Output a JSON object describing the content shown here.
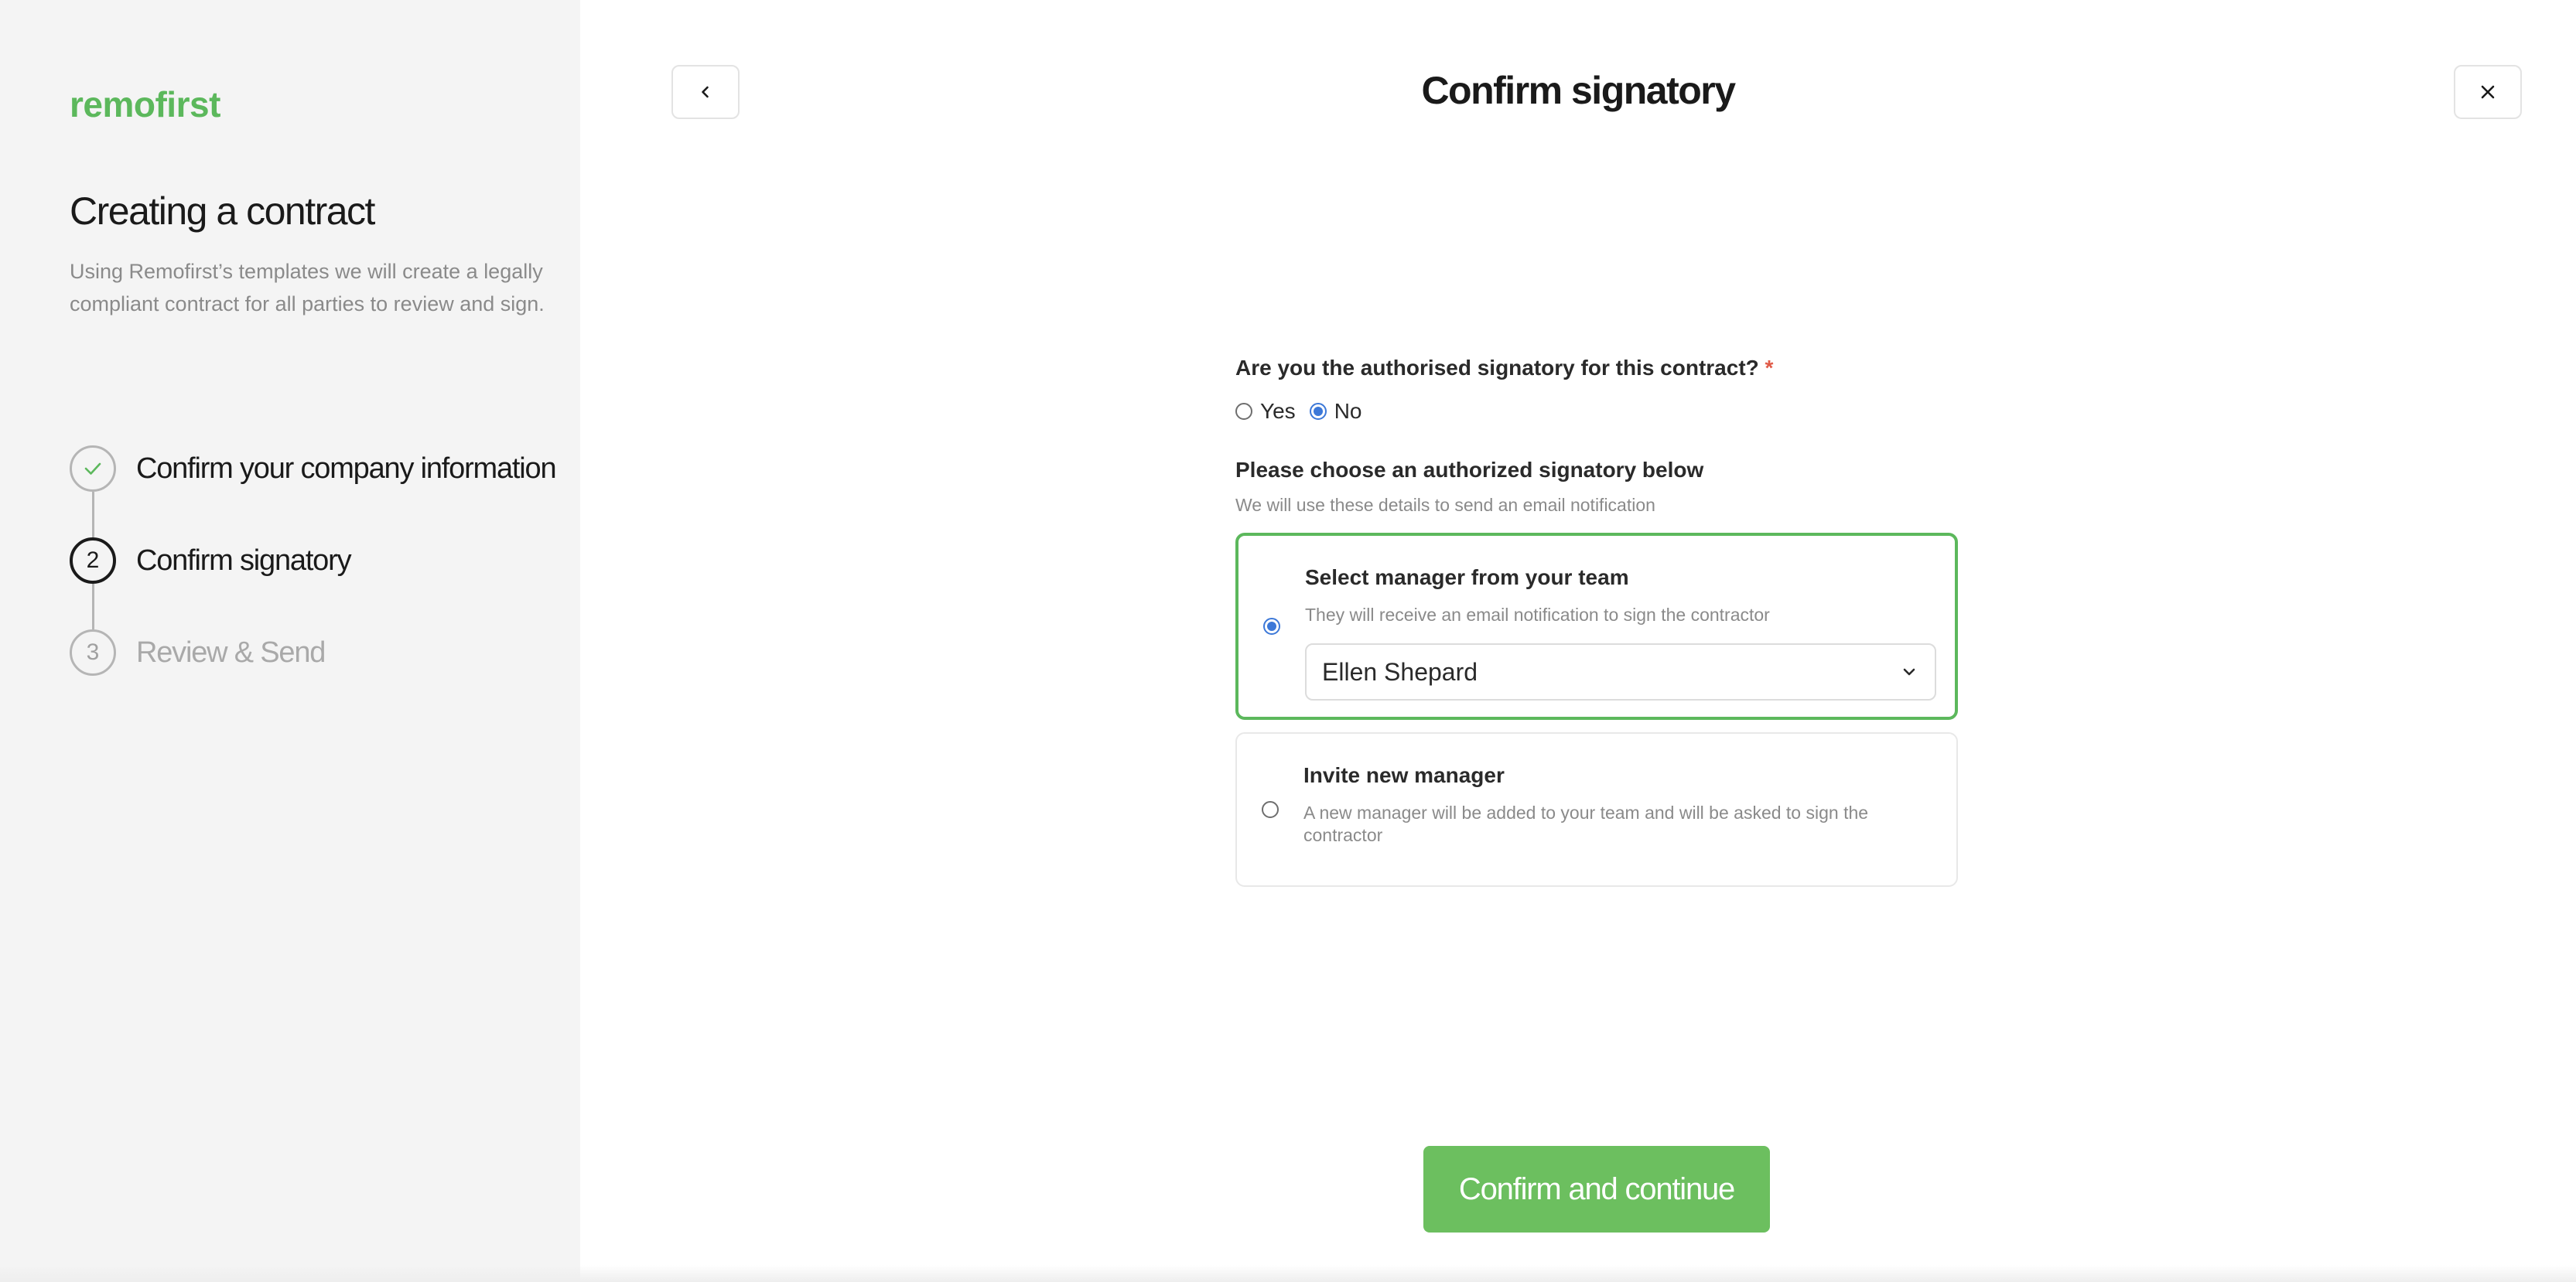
{
  "sidebar": {
    "logo": "remofirst",
    "title": "Creating a contract",
    "description": "Using Remofirst’s templates we will create a legally compliant contract for all parties to review and sign.",
    "steps": [
      {
        "number": "1",
        "label": "Confirm your company information",
        "state": "done"
      },
      {
        "number": "2",
        "label": "Confirm signatory",
        "state": "active"
      },
      {
        "number": "3",
        "label": "Review & Send",
        "state": "pending"
      }
    ]
  },
  "header": {
    "title": "Confirm signatory",
    "back_icon": "chevron-left-icon",
    "close_icon": "close-icon"
  },
  "form": {
    "question": "Are you the authorised signatory for this contract?",
    "required_mark": "*",
    "options": [
      {
        "label": "Yes",
        "checked": false
      },
      {
        "label": "No",
        "checked": true
      }
    ],
    "choose_label": "Please choose an authorized signatory below",
    "choose_hint": "We will use these details to send an email notification",
    "cards": [
      {
        "title": "Select manager from your team",
        "description": "They will receive an email notification to sign the contractor",
        "selected": true,
        "select_value": "Ellen Shepard"
      },
      {
        "title": "Invite new manager",
        "description": "A new manager will be added to your team and will be asked to sign the contractor",
        "selected": false
      }
    ]
  },
  "cta": {
    "label": "Confirm and continue"
  },
  "colors": {
    "accent": "#5cb85c",
    "button": "#6cbf5f",
    "radio": "#3c78d8",
    "required": "#e05a47"
  }
}
